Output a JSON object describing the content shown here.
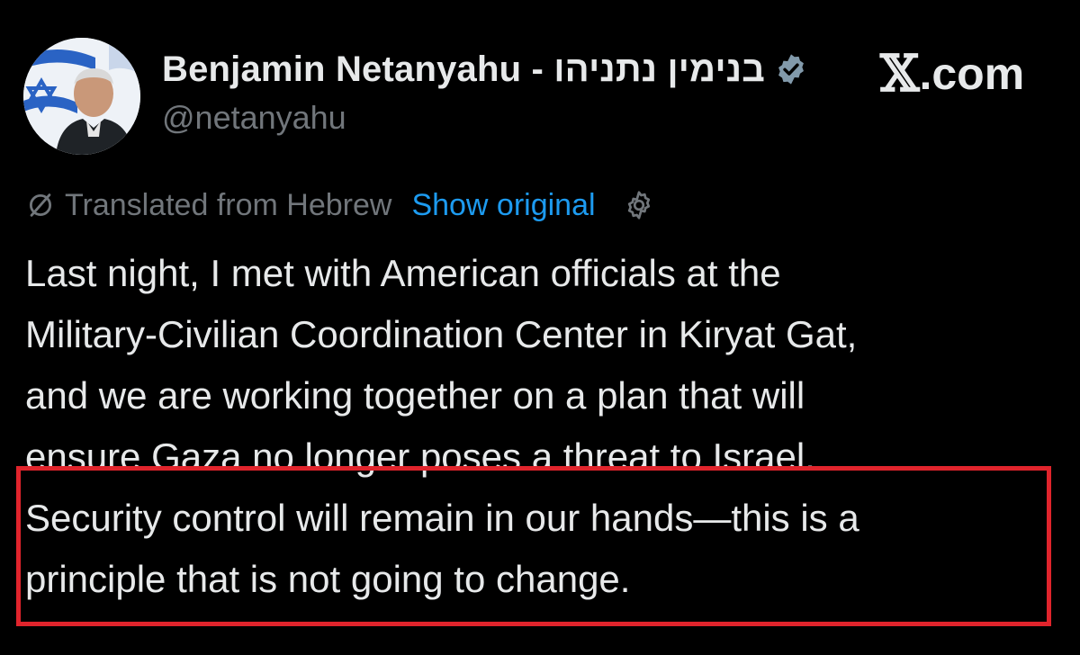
{
  "profile": {
    "display_name": "Benjamin Netanyahu - בנימין נתניהו",
    "handle": "@netanyahu",
    "verified_icon": "verified-badge-icon",
    "avatar_icon": "profile-photo"
  },
  "brand": {
    "x_glyph": "𝕏",
    "suffix": ".com"
  },
  "translation": {
    "note": "Translated from Hebrew",
    "show_original": "Show original",
    "icon": "translate-slash-icon",
    "settings_icon": "gear-icon"
  },
  "post": {
    "lines": [
      "Last night, I met with American officials at the",
      "Military-Civilian Coordination Center in Kiryat Gat,",
      "and we are working together on a plan that will",
      "ensure Gaza no longer poses a threat to Israel.",
      "Security control will remain in our hands—this is a",
      "principle that is not going to change."
    ]
  },
  "colors": {
    "background": "#000000",
    "primary_text": "#e7e9ea",
    "secondary_text": "#71767b",
    "link": "#1d9bf0",
    "highlight": "#e0242c",
    "verified_badge": "#829aab"
  }
}
